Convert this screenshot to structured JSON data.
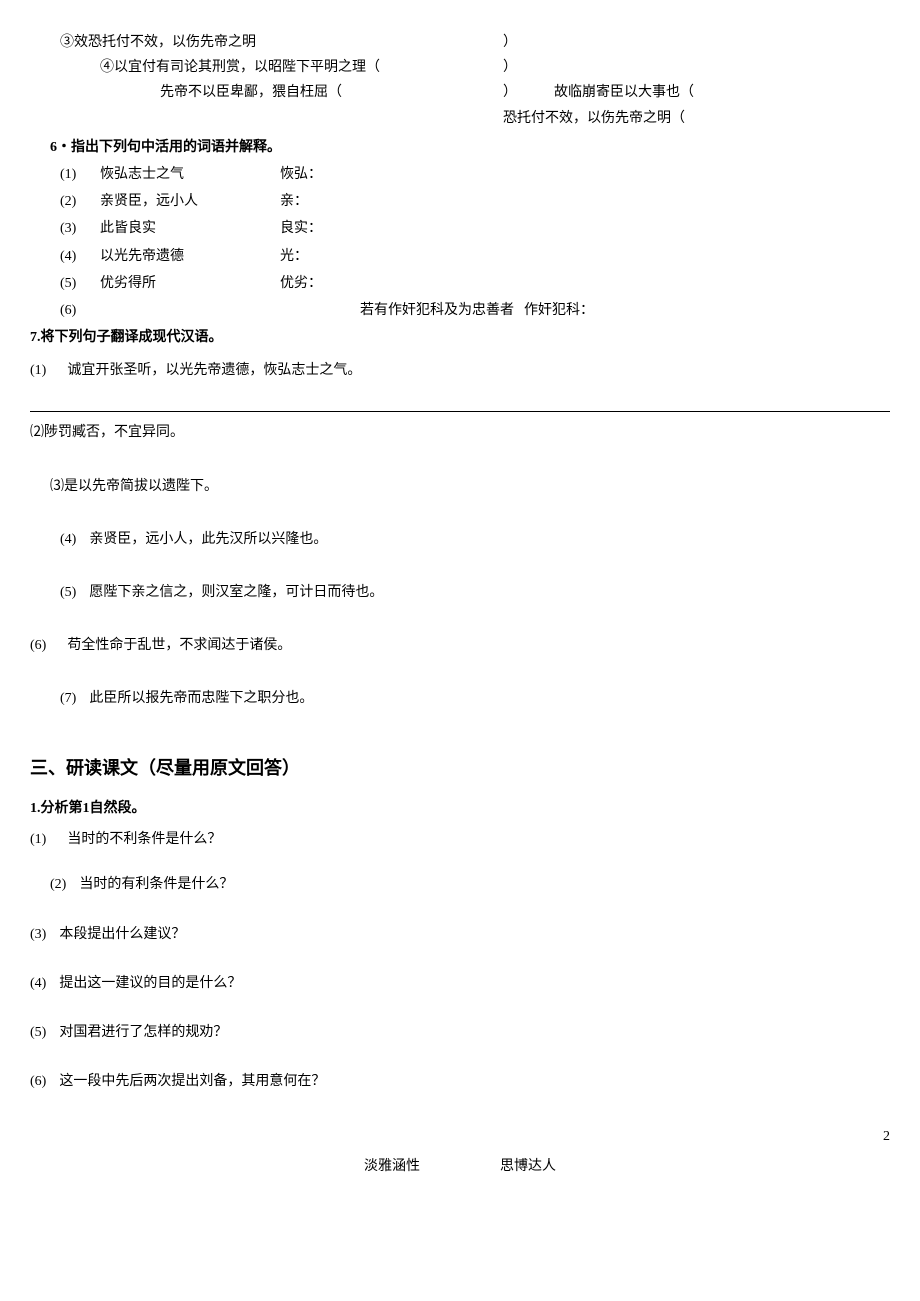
{
  "top": {
    "line3": "③效恐托付不效，以伤先帝之明",
    "line4": "④以宜付有司论其刑赏，以昭陛下平明之理（",
    "line5a": "先帝不以臣卑鄙，猥自枉屈（",
    "right1": "）",
    "right2": "）",
    "right3a": "）",
    "right3b": "故临崩寄臣以大事也（",
    "right4": "恐托付不效，以伤先帝之明（"
  },
  "q6": {
    "title": "6・指出下列句中活用的词语并解释。",
    "items": [
      {
        "num": "(1)",
        "text": "恢弘志士之气",
        "label": "恢弘："
      },
      {
        "num": "(2)",
        "text": "亲贤臣，远小人",
        "label": "亲："
      },
      {
        "num": "(3)",
        "text": "此皆良实",
        "label": "良实："
      },
      {
        "num": "(4)",
        "text": "以光先帝遗德",
        "label": "光："
      },
      {
        "num": "(5)",
        "text": "优劣得所",
        "label": "优劣："
      }
    ],
    "item6_num": "(6)",
    "item6_mid": "若有作奸犯科及为忠善者",
    "item6_label": "作奸犯科："
  },
  "q7": {
    "title": "7.将下列句子翻译成现代汉语。",
    "items": [
      {
        "num": "(1)",
        "text": "诚宜开张圣听，以光先帝遗德，恢弘志士之气。"
      },
      {
        "num": "⑵",
        "text": "陟罚臧否，不宜异同。"
      },
      {
        "num": "⑶",
        "text": "是以先帝简拔以遗陛下。"
      },
      {
        "num": "(4)",
        "text": "亲贤臣，远小人，此先汉所以兴隆也。"
      },
      {
        "num": "(5)",
        "text": "愿陛下亲之信之，则汉室之隆，可计日而待也。"
      },
      {
        "num": "(6)",
        "text": "苟全性命于乱世，不求闻达于诸侯。"
      },
      {
        "num": "(7)",
        "text": "此臣所以报先帝而忠陛下之职分也。"
      }
    ]
  },
  "section3": {
    "title": "三、研读课文（尽量用原文回答）",
    "q1_title": "1.分析第1自然段。",
    "subs": [
      {
        "num": "(1)",
        "text": "当时的不利条件是什么？",
        "indent": false
      },
      {
        "num": "(2)",
        "text": "当时的有利条件是什么？",
        "indent": true
      },
      {
        "num": "(3)",
        "text": "本段提出什么建议？",
        "indent": false
      },
      {
        "num": "(4)",
        "text": "提出这一建议的目的是什么？",
        "indent": false
      },
      {
        "num": "(5)",
        "text": "对国君进行了怎样的规劝？",
        "indent": false
      },
      {
        "num": "(6)",
        "text": "这一段中先后两次提出刘备，其用意何在？",
        "indent": false
      }
    ]
  },
  "footer": {
    "left": "淡雅涵性",
    "right": "思博达人"
  },
  "pageNum": "2"
}
